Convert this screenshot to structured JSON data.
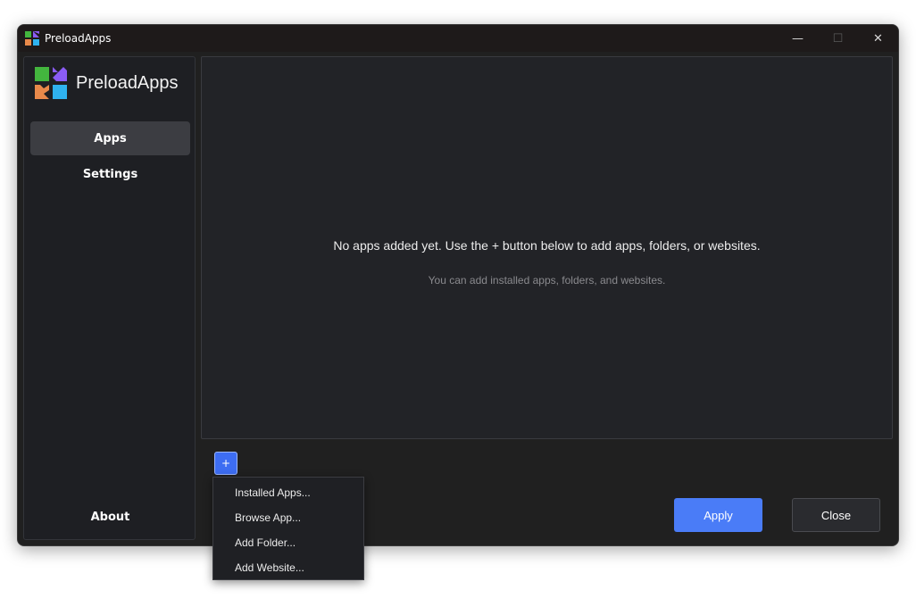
{
  "window": {
    "title": "PreloadApps",
    "controls": {
      "minimize": "—",
      "maximize": "☐",
      "close": "✕"
    }
  },
  "sidebar": {
    "brand": "PreloadApps",
    "items": [
      {
        "label": "Apps",
        "active": true
      },
      {
        "label": "Settings",
        "active": false
      }
    ],
    "footer": {
      "label": "About"
    }
  },
  "content": {
    "empty_message": "No apps added yet. Use the + button below to add apps, folders, or websites.",
    "empty_hint": "You can add installed apps, folders, and websites."
  },
  "toolbar": {
    "add_label": "+",
    "apply_label": "Apply",
    "close_label": "Close"
  },
  "add_menu": {
    "items": [
      {
        "label": "Installed Apps..."
      },
      {
        "label": "Browse App..."
      },
      {
        "label": "Add Folder..."
      },
      {
        "label": "Add Website..."
      }
    ]
  },
  "colors": {
    "logo_green": "#43b53e",
    "logo_purple": "#8b5cf6",
    "logo_orange": "#e8894a",
    "logo_blue": "#2fb2ef",
    "accent": "#4a7cf7"
  }
}
